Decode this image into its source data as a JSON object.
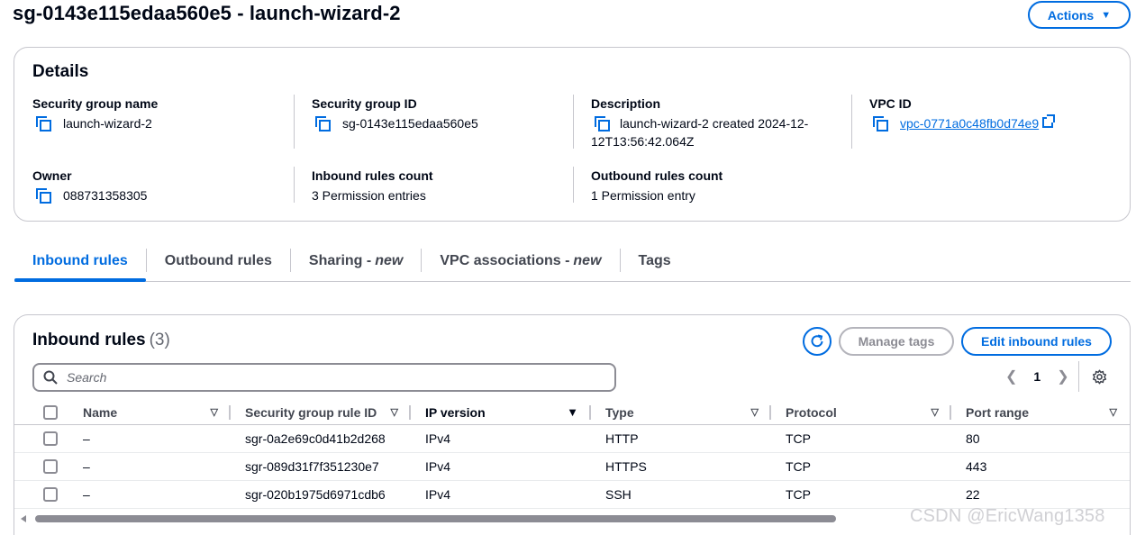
{
  "page": {
    "title": "sg-0143e115edaa560e5 - launch-wizard-2",
    "actions_label": "Actions"
  },
  "details": {
    "title": "Details",
    "sg_name_label": "Security group name",
    "sg_name": "launch-wizard-2",
    "sg_id_label": "Security group ID",
    "sg_id": "sg-0143e115edaa560e5",
    "description_label": "Description",
    "description": "launch-wizard-2 created 2024-12-12T13:56:42.064Z",
    "vpc_label": "VPC ID",
    "vpc_id": "vpc-0771a0c48fb0d74e9",
    "owner_label": "Owner",
    "owner": "088731358305",
    "inbound_count_label": "Inbound rules count",
    "inbound_count": "3 Permission entries",
    "outbound_count_label": "Outbound rules count",
    "outbound_count": "1 Permission entry"
  },
  "tabs": [
    {
      "label": "Inbound rules",
      "suffix": "",
      "active": true
    },
    {
      "label": "Outbound rules",
      "suffix": ""
    },
    {
      "label": "Sharing -",
      "suffix": "new"
    },
    {
      "label": "VPC associations -",
      "suffix": "new"
    },
    {
      "label": "Tags",
      "suffix": ""
    }
  ],
  "rules": {
    "title": "Inbound rules",
    "count": "(3)",
    "manage_tags_label": "Manage tags",
    "edit_label": "Edit inbound rules",
    "search_placeholder": "Search",
    "page_number": "1",
    "columns": [
      "Name",
      "Security group rule ID",
      "IP version",
      "Type",
      "Protocol",
      "Port range"
    ],
    "rows": [
      {
        "name": "–",
        "rule_id": "sgr-0a2e69c0d41b2d268",
        "ip_version": "IPv4",
        "type": "HTTP",
        "protocol": "TCP",
        "port": "80"
      },
      {
        "name": "–",
        "rule_id": "sgr-089d31f7f351230e7",
        "ip_version": "IPv4",
        "type": "HTTPS",
        "protocol": "TCP",
        "port": "443"
      },
      {
        "name": "–",
        "rule_id": "sgr-020b1975d6971cdb6",
        "ip_version": "IPv4",
        "type": "SSH",
        "protocol": "TCP",
        "port": "22"
      }
    ]
  },
  "watermark": "CSDN @EricWang1358",
  "colors": {
    "accent": "#006ce0",
    "text": "#000716",
    "border": "#c6c6cd",
    "disabled": "#8c8c94"
  }
}
